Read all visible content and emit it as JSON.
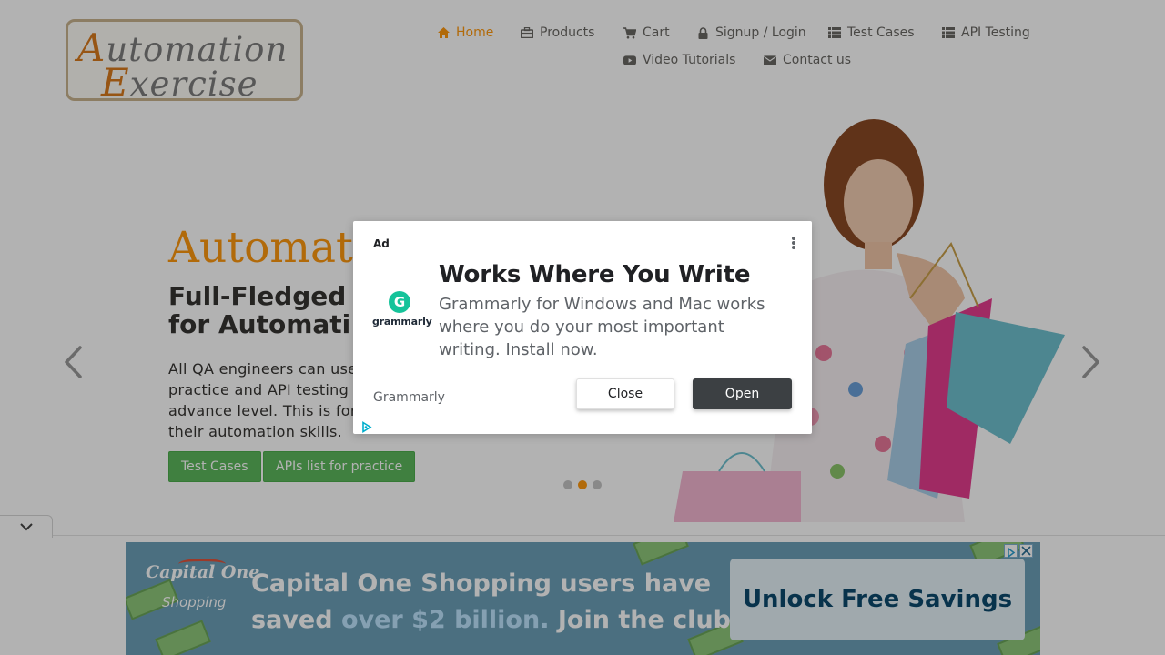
{
  "header": {
    "logo": {
      "line1_initial": "A",
      "line1_rest": "utomation",
      "line2_initial": "E",
      "line2_rest": "xercise"
    },
    "nav": [
      {
        "label": "Home",
        "icon": "home-icon",
        "active": true
      },
      {
        "label": "Products",
        "icon": "products-icon"
      },
      {
        "label": "Cart",
        "icon": "cart-icon"
      },
      {
        "label": "Signup / Login",
        "icon": "lock-icon"
      },
      {
        "label": "Test Cases",
        "icon": "list-icon"
      },
      {
        "label": "API Testing",
        "icon": "list-icon"
      },
      {
        "label": "Video Tutorials",
        "icon": "youtube-icon"
      },
      {
        "label": "Contact us",
        "icon": "envelope-icon"
      }
    ]
  },
  "hero": {
    "title": "Automat",
    "subtitle": "Full-Fledged\nfor Automati",
    "text": "All QA engineers can use\npractice and API testing e\nadvance level. This is for\ntheir automation skills.",
    "buttons": [
      "Test Cases",
      "APIs list for practice"
    ],
    "slides": 3,
    "active_slide": 2
  },
  "ad_dialog": {
    "ad_label": "Ad",
    "brand_word": "grammarly",
    "title": "Works Where You Write",
    "body": "Grammarly for Windows and Mac works where you do your most important writing. Install now.",
    "advertiser": "Grammarly",
    "close_label": "Close",
    "open_label": "Open"
  },
  "banner_ad": {
    "brand_line1": "Capital One",
    "brand_line2": "Shopping",
    "headline_pre": "Capital One Shopping users have saved ",
    "headline_highlight": "over $2 billion.",
    "headline_post": " Join the club!",
    "cta": "Unlock Free Savings"
  },
  "colors": {
    "accent": "#fe980f",
    "button_green": "#5cb85c",
    "dialog_open_button": "#3c4043"
  }
}
